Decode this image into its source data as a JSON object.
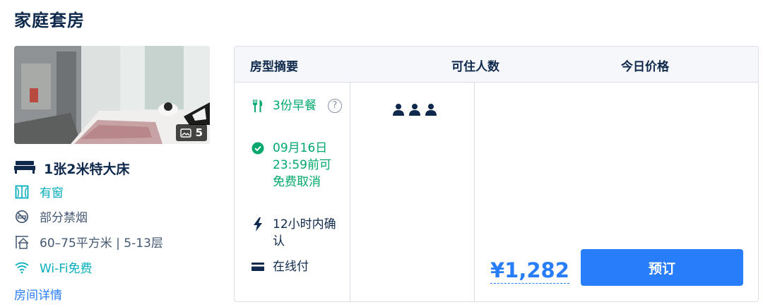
{
  "room": {
    "title": "家庭套房",
    "photo_count": "5",
    "bed": "1张2米特大床",
    "facilities": [
      {
        "icon": "window-icon",
        "label": "有窗",
        "highlight": true
      },
      {
        "icon": "no-smoking-icon",
        "label": "部分禁烟",
        "highlight": false
      },
      {
        "icon": "area-icon",
        "label": "60–75平方米 | 5-13层",
        "highlight": false
      },
      {
        "icon": "wifi-icon",
        "label": "Wi-Fi免费",
        "highlight": true
      }
    ],
    "details_link": "房间详情"
  },
  "table": {
    "headers": {
      "summary": "房型摘要",
      "occupancy": "可住人数",
      "price": "今日价格"
    },
    "policies": {
      "breakfast": "3份早餐",
      "cancellation": "09月16日23:59前可免费取消",
      "confirmation": "12小时内确认",
      "payment": "在线付"
    },
    "help_symbol": "?",
    "occupancy_count": 3,
    "price": "¥1,282",
    "book_label": "预订"
  },
  "colors": {
    "primary": "#287dfa",
    "text": "#0f294d",
    "green": "#00a86b",
    "teal": "#06aebd",
    "secondary": "#455873",
    "border": "#dadfe6",
    "header_bg": "#f5f7fa"
  }
}
